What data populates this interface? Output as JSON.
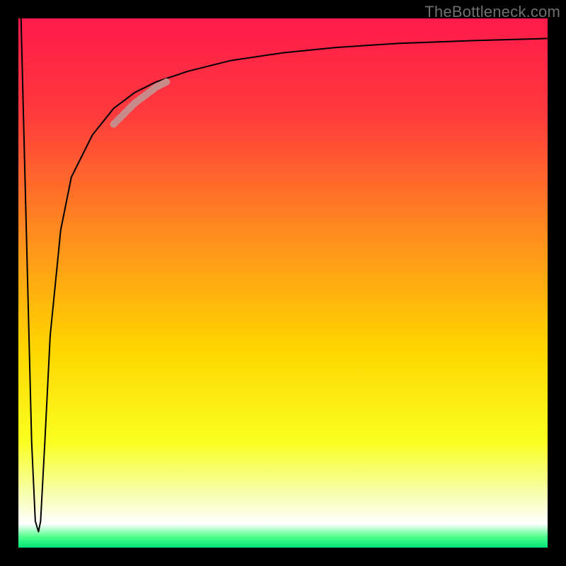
{
  "watermark": "TheBottleneck.com",
  "gradient": {
    "stops": [
      {
        "offset": 0.0,
        "color": "#ff1a4b"
      },
      {
        "offset": 0.18,
        "color": "#ff3a3d"
      },
      {
        "offset": 0.4,
        "color": "#ff8a1f"
      },
      {
        "offset": 0.62,
        "color": "#ffd400"
      },
      {
        "offset": 0.8,
        "color": "#faff20"
      },
      {
        "offset": 0.9,
        "color": "#f6ffb0"
      },
      {
        "offset": 0.955,
        "color": "#ffffff"
      },
      {
        "offset": 0.98,
        "color": "#4cff88"
      },
      {
        "offset": 1.0,
        "color": "#00e47a"
      }
    ]
  },
  "chart_data": {
    "type": "line",
    "title": "",
    "xlabel": "",
    "ylabel": "",
    "xlim": [
      0,
      100
    ],
    "ylim": [
      0,
      100
    ],
    "series": [
      {
        "name": "curve",
        "x": [
          0.5,
          1.5,
          2.5,
          3.2,
          3.8,
          4.2,
          5,
          6,
          8,
          10,
          14,
          18,
          22,
          26,
          32,
          40,
          50,
          60,
          72,
          86,
          100
        ],
        "values": [
          100,
          60,
          20,
          5,
          3,
          5,
          20,
          40,
          60,
          70,
          78,
          83,
          86,
          88,
          90,
          92,
          93.5,
          94.5,
          95.3,
          95.8,
          96.2
        ]
      }
    ],
    "highlight": {
      "name": "highlight-segment",
      "color": "#c98a8a",
      "x": [
        18,
        20,
        22,
        24,
        26,
        28
      ],
      "values": [
        80,
        82,
        84,
        85.5,
        87,
        88
      ]
    }
  }
}
